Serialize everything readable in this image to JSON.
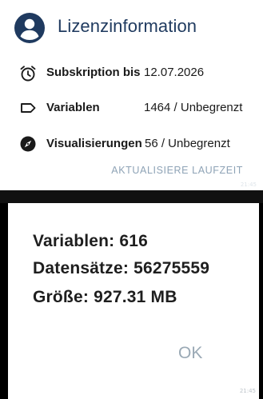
{
  "license_panel": {
    "title": "Lizenzinformation",
    "rows": [
      {
        "icon": "alarm-clock-icon",
        "label": "Subskription bis",
        "value": "12.07.2026"
      },
      {
        "icon": "label-tag-icon",
        "label": "Variablen",
        "value": "1464 / Unbegrenzt"
      },
      {
        "icon": "compass-icon",
        "label": "Visualisierungen",
        "value": "56 / Unbegrenzt"
      }
    ],
    "update_button": "AKTUALISIERE LAUFZEIT",
    "timestamp": "21:45"
  },
  "stats_dialog": {
    "lines": [
      "Variablen: 616",
      "Datensätze: 56275559",
      "Größe: 927.31 MB"
    ],
    "ok_button": "OK",
    "timestamp": "21:45"
  },
  "colors": {
    "title": "#1f3a5f",
    "accent_muted": "#8ea3b6",
    "background": "#ffffff",
    "separator": "#111111"
  }
}
